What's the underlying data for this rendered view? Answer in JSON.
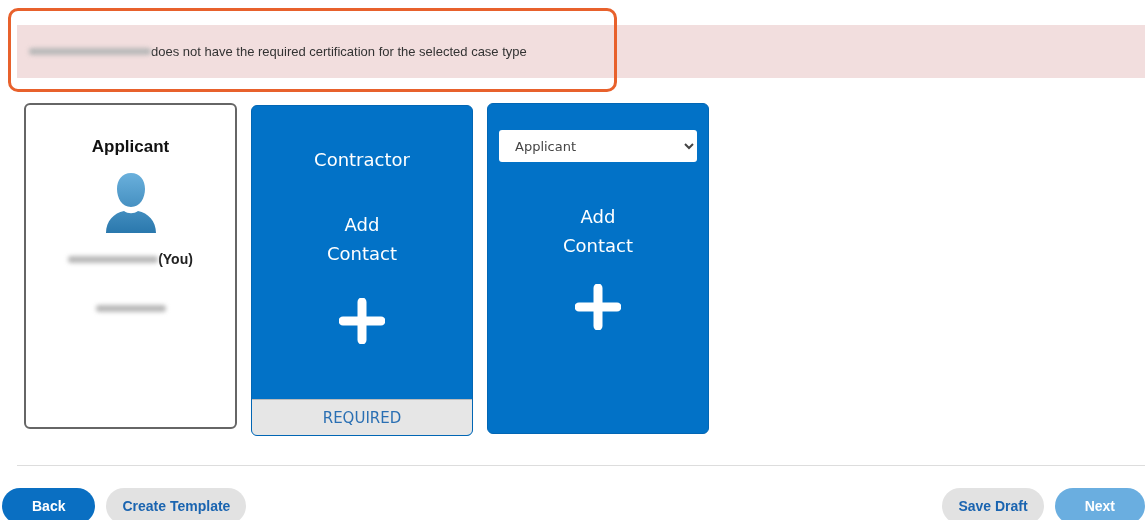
{
  "alert": {
    "message": "does not have the required certification for the selected case type",
    "highlighted": true
  },
  "cards": [
    {
      "kind": "applicant",
      "title": "Applicant",
      "you_label": "(You)"
    },
    {
      "kind": "role",
      "role": "Contractor",
      "action": "Add Contact",
      "required": true,
      "footer": "REQUIRED"
    },
    {
      "kind": "select",
      "selected_role": "Applicant",
      "action": "Add Contact"
    }
  ],
  "footer": {
    "left": [
      {
        "label": "Back",
        "kind": "primary",
        "disabled": false
      },
      {
        "label": "Create Template",
        "kind": "secondary",
        "disabled": false
      }
    ],
    "right": [
      {
        "label": "Save Draft",
        "kind": "secondary",
        "disabled": false
      },
      {
        "label": "Next",
        "kind": "primary",
        "disabled": true
      }
    ]
  }
}
